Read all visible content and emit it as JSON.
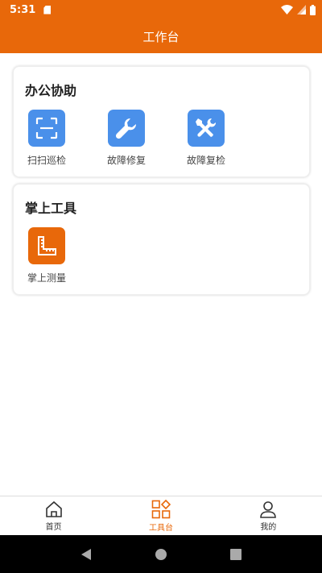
{
  "status_bar": {
    "time": "5:31"
  },
  "header": {
    "title": "工作台"
  },
  "sections": [
    {
      "title": "办公协助",
      "items": [
        {
          "label": "扫扫巡检",
          "icon": "scan-icon",
          "color": "#4a90ea"
        },
        {
          "label": "故障修复",
          "icon": "wrench-icon",
          "color": "#4a90ea"
        },
        {
          "label": "故障复检",
          "icon": "tools-icon",
          "color": "#4a90ea"
        }
      ]
    },
    {
      "title": "掌上工具",
      "items": [
        {
          "label": "掌上测量",
          "icon": "ruler-icon",
          "color": "#e8680a"
        }
      ]
    }
  ],
  "tabs": [
    {
      "label": "首页",
      "icon": "home-icon",
      "active": false
    },
    {
      "label": "工具台",
      "icon": "grid-icon",
      "active": true
    },
    {
      "label": "我的",
      "icon": "user-icon",
      "active": false
    }
  ],
  "theme": {
    "accent": "#e8680a",
    "icon_blue": "#4a90ea"
  }
}
